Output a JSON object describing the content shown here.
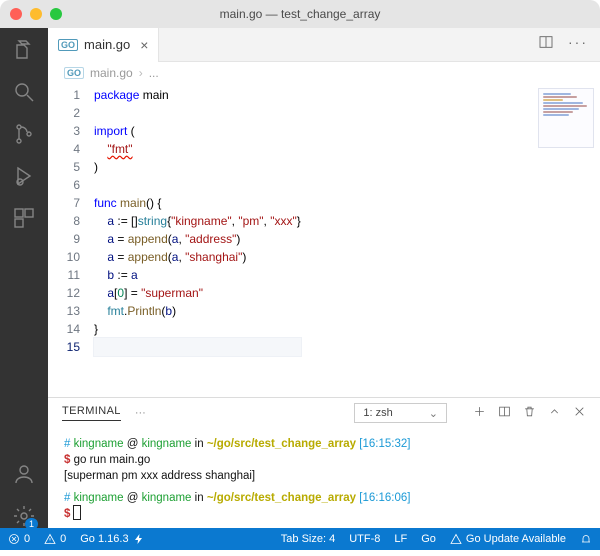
{
  "window": {
    "title": "main.go — test_change_array"
  },
  "tab": {
    "filename": "main.go",
    "lang_chip": "GO"
  },
  "breadcrumb": {
    "lang_chip": "GO",
    "file": "main.go",
    "sep": "›",
    "rest": "..."
  },
  "lines": [
    "1",
    "2",
    "3",
    "4",
    "5",
    "6",
    "7",
    "8",
    "9",
    "10",
    "11",
    "12",
    "13",
    "14",
    "15"
  ],
  "current_line": 15,
  "code": {
    "l1": {
      "a": "package",
      "b": " main"
    },
    "l3": {
      "a": "import",
      "b": " ("
    },
    "l4": {
      "a": "\"fmt\""
    },
    "l5": {
      "a": ")"
    },
    "l7": {
      "a": "func",
      "b": " ",
      "c": "main",
      "d": "() {"
    },
    "l8": {
      "a": "a",
      "b": " := []",
      "c": "string",
      "d": "{",
      "e": "\"kingname\"",
      "f": ", ",
      "g": "\"pm\"",
      "h": ", ",
      "i": "\"xxx\"",
      "j": "}"
    },
    "l9": {
      "a": "a",
      "b": " = ",
      "c": "append",
      "d": "(",
      "e": "a",
      "f": ", ",
      "g": "\"address\"",
      "h": ")"
    },
    "l10": {
      "a": "a",
      "b": " = ",
      "c": "append",
      "d": "(",
      "e": "a",
      "f": ", ",
      "g": "\"shanghai\"",
      "h": ")"
    },
    "l11": {
      "a": "b",
      "b": " := ",
      "c": "a"
    },
    "l12": {
      "a": "a",
      "b": "[",
      "c": "0",
      "d": "] = ",
      "e": "\"superman\""
    },
    "l13": {
      "a": "fmt",
      "b": ".",
      "c": "Println",
      "d": "(",
      "e": "b",
      "f": ")"
    },
    "l14": {
      "a": "}"
    }
  },
  "panel": {
    "tab": "TERMINAL",
    "select_label": "1: zsh"
  },
  "terminal": {
    "p1": {
      "hash": "#",
      "user": "kingname",
      "at": "@",
      "host": "kingname",
      "in": "in",
      "path": "~/go/src/test_change_array",
      "time": "[16:15:32]"
    },
    "cmd1": {
      "dollar": "$",
      "cmd": "go run main.go"
    },
    "out1": "[superman pm xxx address shanghai]",
    "p2": {
      "hash": "#",
      "user": "kingname",
      "at": "@",
      "host": "kingname",
      "in": "in",
      "path": "~/go/src/test_change_array",
      "time": "[16:16:06]"
    },
    "cmd2": {
      "dollar": "$"
    }
  },
  "status": {
    "errors": "0",
    "warnings": "0",
    "go_version": "Go 1.16.3",
    "tab_size": "Tab Size: 4",
    "encoding": "UTF-8",
    "eol": "LF",
    "lang": "Go",
    "update": "Go Update Available"
  }
}
